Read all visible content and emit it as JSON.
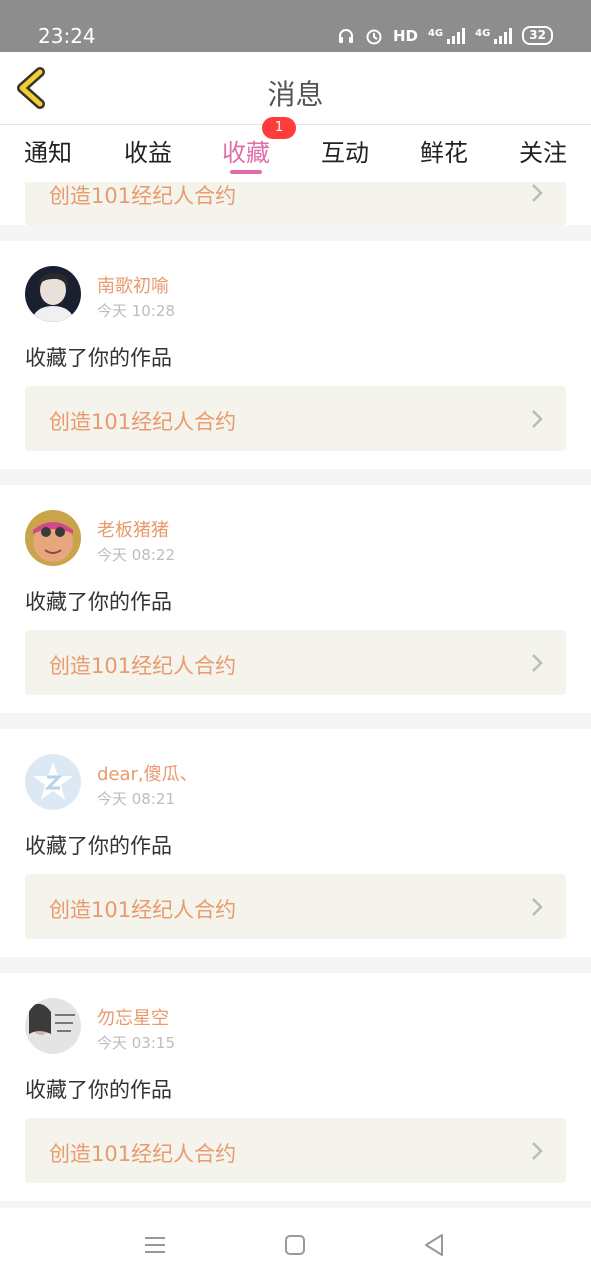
{
  "status_bar": {
    "time": "23:24",
    "hd_label": "HD",
    "signal_1_label": "4G",
    "signal_2_label": "4G",
    "battery": "32",
    "icons": [
      "headphones-icon",
      "alarm-icon",
      "hd-icon",
      "signal-icon",
      "signal-icon",
      "battery-icon"
    ]
  },
  "header": {
    "title": "消息",
    "back_icon": "chevron-left-icon"
  },
  "tabs": [
    {
      "label": "通知"
    },
    {
      "label": "收益"
    },
    {
      "label": "收藏",
      "badge": "1",
      "active": true
    },
    {
      "label": "互动"
    },
    {
      "label": "鲜花"
    },
    {
      "label": "关注"
    }
  ],
  "colors": {
    "accent_pink": "#e06ea8",
    "orange_text": "#e99a6e",
    "badge_red": "#ff3b3b",
    "status_bar_gray": "#8d8d8d",
    "work_box_bg": "#f4f4ec",
    "back_arrow_yellow": "#f2cf2d"
  },
  "feed": {
    "partial_item": {
      "work_title": "创造101经纪人合约"
    },
    "items": [
      {
        "username": "南歌初喻",
        "time": "今天 10:28",
        "action": "收藏了你的作品",
        "work_title": "创造101经纪人合约",
        "avatar": "avatar-photo"
      },
      {
        "username": "老板猪猪",
        "time": "今天 08:22",
        "action": "收藏了你的作品",
        "work_title": "创造101经纪人合约",
        "avatar": "avatar-photo"
      },
      {
        "username": "dear,傻瓜、",
        "time": "今天 08:21",
        "action": "收藏了你的作品",
        "work_title": "创造101经纪人合约",
        "avatar": "default-avatar-icon"
      },
      {
        "username": "勿忘星空",
        "time": "今天 03:15",
        "action": "收藏了你的作品",
        "work_title": "创造101经纪人合约",
        "avatar": "avatar-photo"
      }
    ]
  },
  "nav_bar": {
    "icons": [
      "menu-icon",
      "home-square-icon",
      "back-triangle-icon"
    ]
  }
}
